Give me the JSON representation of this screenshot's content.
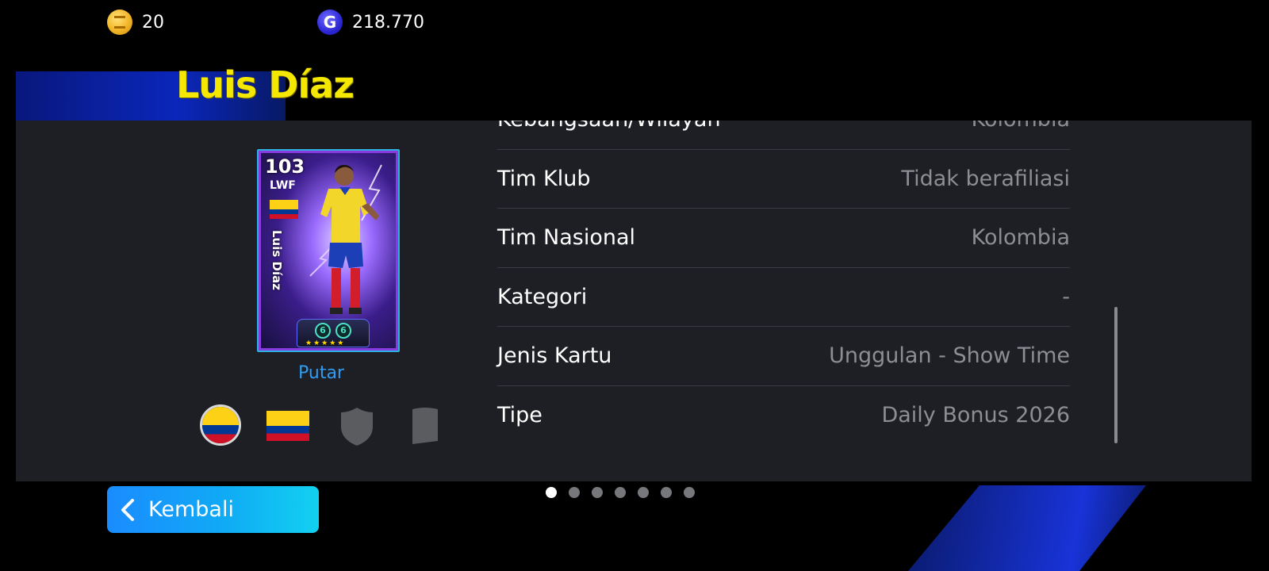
{
  "currency": {
    "coins": {
      "icon": "coin-icon",
      "value": "20"
    },
    "gp": {
      "icon": "gp-icon",
      "icon_letter": "G",
      "value": "218.770"
    }
  },
  "player": {
    "name": "Luis Díaz"
  },
  "card": {
    "rating": "103",
    "position": "LWF",
    "vertical_name": "Luis Díaz",
    "badge_level_1": "6",
    "badge_level_2": "6",
    "stars": "★★★★★"
  },
  "rotate_label": "Putar",
  "bottom_icons": [
    "nationality-circle-icon",
    "flag-icon",
    "club-shield-icon",
    "league-badge-icon"
  ],
  "info": {
    "rows": [
      {
        "label": "Kebangsaan/Wilayah",
        "value": "Kolombia"
      },
      {
        "label": "Tim Klub",
        "value": "Tidak berafiliasi"
      },
      {
        "label": "Tim Nasional",
        "value": "Kolombia"
      },
      {
        "label": "Kategori",
        "value": "-"
      },
      {
        "label": "Jenis Kartu",
        "value": "Unggulan - Show Time"
      },
      {
        "label": "Tipe",
        "value": "Daily Bonus 2026"
      }
    ]
  },
  "pagination": {
    "total": 7,
    "current": 1
  },
  "back_button": {
    "label": "Kembali",
    "icon": "chevron-left-icon"
  },
  "colors": {
    "name_yellow": "#f5e800",
    "link_blue": "#2f9cf2",
    "panel_bg": "#1e1f24",
    "value_gray": "#8d8e94"
  }
}
